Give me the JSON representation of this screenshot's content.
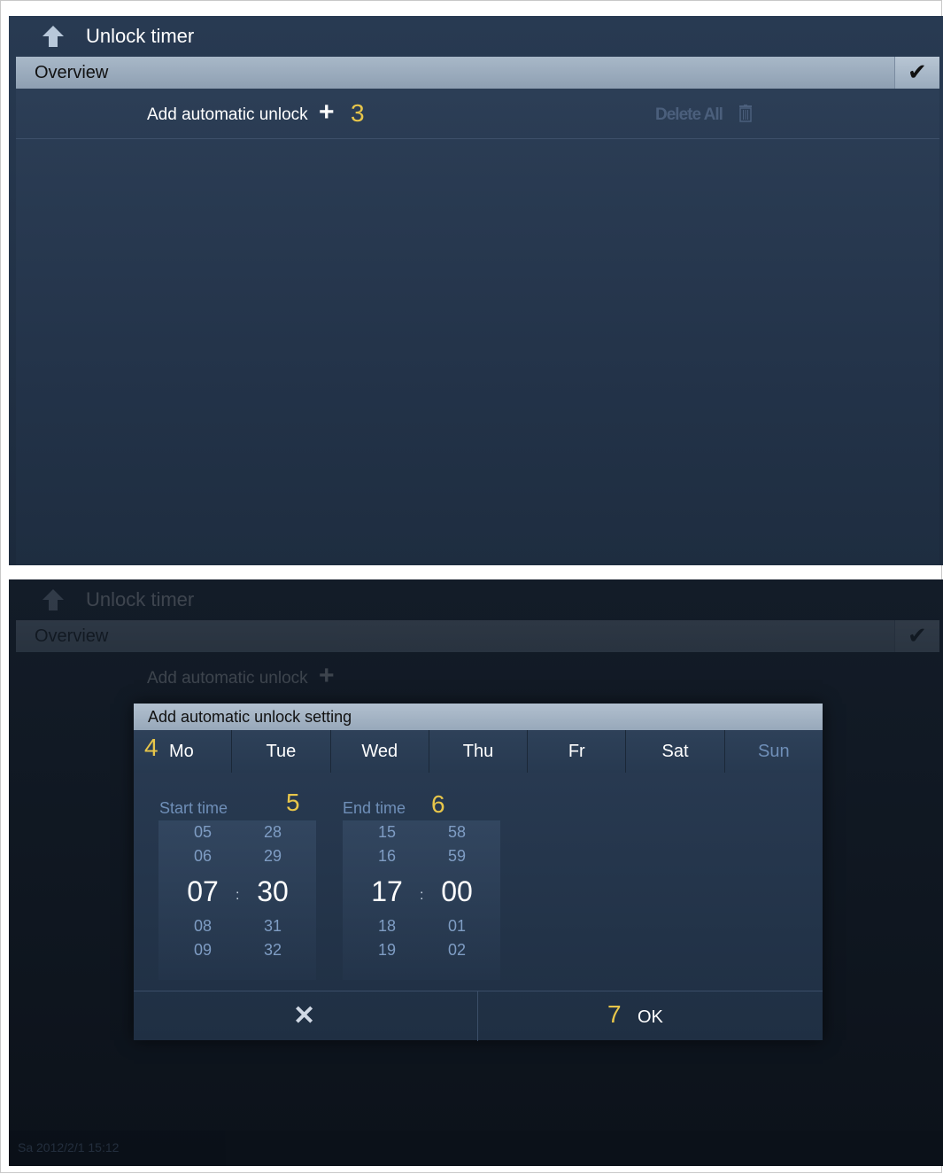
{
  "screen1": {
    "title": "Unlock timer",
    "overview_label": "Overview",
    "check_glyph": "✔",
    "add_label": "Add automatic unlock",
    "add_plus": "+",
    "delete_all_label": "Delete All",
    "annotation": "3"
  },
  "screen2": {
    "title": "Unlock timer",
    "overview_label": "Overview",
    "add_label": "Add automatic unlock",
    "dialog": {
      "title": "Add automatic unlock setting",
      "days": [
        "Mo",
        "Tue",
        "Wed",
        "Thu",
        "Fr",
        "Sat",
        "Sun"
      ],
      "day_annotation": "4",
      "start_label": "Start time",
      "start_annotation": "5",
      "end_label": "End time",
      "end_annotation": "6",
      "start": {
        "hours": [
          "05",
          "06",
          "07",
          "08",
          "09"
        ],
        "minutes": [
          "28",
          "29",
          "30",
          "31",
          "32"
        ]
      },
      "end": {
        "hours": [
          "15",
          "16",
          "17",
          "18",
          "19"
        ],
        "minutes": [
          "58",
          "59",
          "00",
          "01",
          "02"
        ]
      },
      "colon": ":",
      "cancel_glyph": "✕",
      "ok_label": "OK",
      "ok_annotation": "7"
    },
    "status_text": "Sa 2012/2/1 15:12"
  },
  "colors": {
    "annotation": "#e8c64a",
    "muted_text": "#6f8fb8"
  }
}
